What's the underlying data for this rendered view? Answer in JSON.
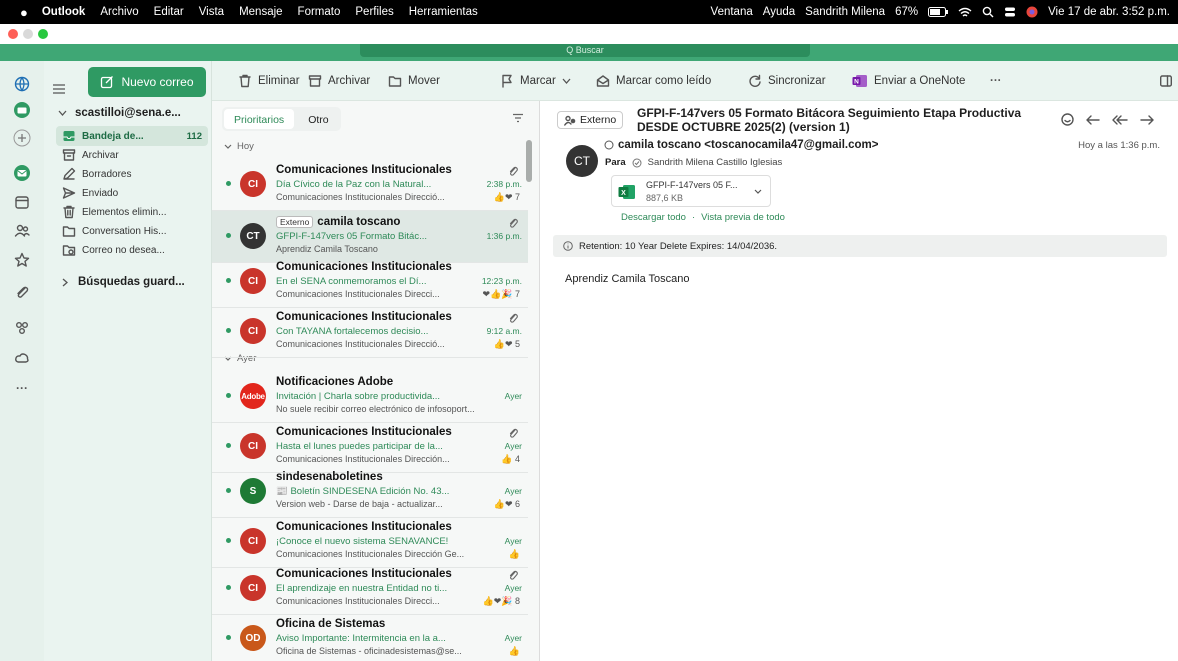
{
  "menubar": {
    "app": "Outlook",
    "items": [
      "Archivo",
      "Editar",
      "Vista",
      "Mensaje",
      "Formato",
      "Perfiles",
      "Herramientas"
    ],
    "right_items": [
      "Ventana",
      "Ayuda",
      "Sandrith Milena"
    ],
    "battery": "67%",
    "datetime": "Vie 17 de abr. 3:52 p.m."
  },
  "search": {
    "placeholder": "Q Buscar"
  },
  "new_mail": "Nuevo correo",
  "toolbar": {
    "delete": "Eliminar",
    "archive": "Archivar",
    "move": "Mover",
    "flag": "Marcar",
    "mark_read": "Marcar como leído",
    "sync": "Sincronizar",
    "onenote": "Enviar a OneNote",
    "more": "···"
  },
  "account": "scastilloi@sena.e...",
  "folders": [
    {
      "label": "Bandeja de...",
      "count": "112",
      "icon": "inbox-icon"
    },
    {
      "label": "Archivar",
      "count": "",
      "icon": "archive-icon"
    },
    {
      "label": "Borradores",
      "count": "",
      "icon": "pencil-icon"
    },
    {
      "label": "Enviado",
      "count": "",
      "icon": "send-icon"
    },
    {
      "label": "Elementos elimin...",
      "count": "",
      "icon": "trash-icon"
    },
    {
      "label": "Conversation His...",
      "count": "",
      "icon": "folder-icon"
    },
    {
      "label": "Correo no desea...",
      "count": "",
      "icon": "junk-icon"
    }
  ],
  "saved_searches": "Búsquedas guard...",
  "list": {
    "tab_focused": "Prioritarios",
    "tab_other": "Otro",
    "sec_today": "Hoy",
    "sec_yesterday": "Ayer",
    "messages": [
      {
        "initials": "CI",
        "color": "#c9352b",
        "sender": "Comunicaciones Institucionales",
        "subject": "Día Cívico de la Paz con la Natural...",
        "time": "2:38 p.m.",
        "preview": "Comunicaciones Institucionales Direcció...",
        "extra": "👍❤ 7",
        "attach": true,
        "badge": "",
        "selected": false
      },
      {
        "initials": "CT",
        "color": "#333333",
        "sender": "camila toscano",
        "subject": "GFPI-F-147vers 05 Formato Bitác...",
        "time": "1:36 p.m.",
        "preview": "Aprendiz Camila Toscano",
        "extra": "",
        "attach": true,
        "badge": "Externo",
        "selected": true
      },
      {
        "initials": "CI",
        "color": "#c9352b",
        "sender": "Comunicaciones Institucionales",
        "subject": "En el SENA conmemoramos el Dí...",
        "time": "12:23 p.m.",
        "preview": "Comunicaciones Institucionales Direcci...",
        "extra": "❤👍🎉 7",
        "attach": false,
        "badge": "",
        "selected": false
      },
      {
        "initials": "CI",
        "color": "#c9352b",
        "sender": "Comunicaciones Institucionales",
        "subject": "Con TAYANA fortalecemos decisio...",
        "time": "9:12 a.m.",
        "preview": "Comunicaciones Institucionales Direcció...",
        "extra": "👍❤ 5",
        "attach": true,
        "badge": "",
        "selected": false
      },
      {
        "initials": "Adobe",
        "color": "#e2261c",
        "sender": "Notificaciones Adobe",
        "subject": "Invitación | Charla sobre productivida...",
        "time": "Ayer",
        "preview": "No suele recibir correo electrónico de infosoport...",
        "extra": "",
        "attach": false,
        "badge": "",
        "selected": false
      },
      {
        "initials": "CI",
        "color": "#c9352b",
        "sender": "Comunicaciones Institucionales",
        "subject": "Hasta el lunes puedes participar de la...",
        "time": "Ayer",
        "preview": "Comunicaciones Institucionales Dirección...",
        "extra": "👍 4",
        "attach": true,
        "badge": "",
        "selected": false
      },
      {
        "initials": "S",
        "color": "#1e7a35",
        "sender": "sindesenaboletines",
        "subject": "📰 Boletín SINDESENA Edición No. 43...",
        "time": "Ayer",
        "preview": "Version web - Darse de baja - actualizar...",
        "extra": "👍❤ 6",
        "attach": false,
        "badge": "",
        "selected": false
      },
      {
        "initials": "CI",
        "color": "#c9352b",
        "sender": "Comunicaciones Institucionales",
        "subject": "¡Conoce el nuevo sistema SENAVANCE!",
        "time": "Ayer",
        "preview": "Comunicaciones Institucionales Dirección Ge...",
        "extra": "👍",
        "attach": false,
        "badge": "",
        "selected": false
      },
      {
        "initials": "CI",
        "color": "#c9352b",
        "sender": "Comunicaciones Institucionales",
        "subject": "El aprendizaje en nuestra Entidad no ti...",
        "time": "Ayer",
        "preview": "Comunicaciones Institucionales Direcci...",
        "extra": "👍❤🎉 8",
        "attach": true,
        "badge": "",
        "selected": false
      },
      {
        "initials": "OD",
        "color": "#c9581a",
        "sender": "Oficina de Sistemas",
        "subject": "Aviso Importante: Intermitencia en la a...",
        "time": "Ayer",
        "preview": "Oficina de Sistemas - oficinadesistemas@se...",
        "extra": "👍",
        "attach": false,
        "badge": "",
        "selected": false
      }
    ]
  },
  "reading": {
    "external_tag": "Externo",
    "subject": "GFPI-F-147vers 05 Formato Bitácora Seguimiento Etapa Productiva DESDE OCTUBRE 2025(2) (version 1)",
    "sender_initials": "CT",
    "sender": "camila toscano <toscanocamila47@gmail.com>",
    "to_label": "Para",
    "to": "Sandrith Milena Castillo Iglesias",
    "received": "Hoy a las 1:36 p.m.",
    "attachment_name": "GFPI-F-147vers 05 F...",
    "attachment_size": "887,6 KB",
    "download_all": "Descargar todo",
    "preview_all": "Vista previa de todo",
    "separator": "·",
    "retention": "Retention: 10 Year Delete Expires: 14/04/2036.",
    "body": "Aprendiz Camila Toscano"
  },
  "colors": {
    "accent": "#2f9a63",
    "rail": "#e6f1ec",
    "selected": "#dfe8e4"
  }
}
